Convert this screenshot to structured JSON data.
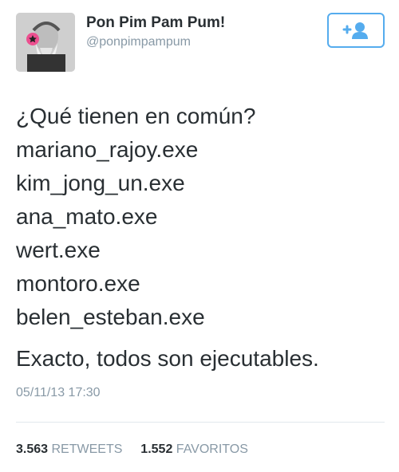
{
  "user": {
    "display_name": "Pon Pim Pam Pum!",
    "handle": "@ponpimpampum",
    "avatar_icon": "bearded-man-headphones-avatar",
    "follow_icon": "add-user-icon"
  },
  "tweet": {
    "lines": [
      "¿Qué tienen en común?",
      "mariano_rajoy.exe",
      "kim_jong_un.exe",
      "ana_mato.exe",
      "wert.exe",
      "montoro.exe",
      "belen_esteban.exe",
      "Exacto, todos son ejecutables."
    ],
    "timestamp": "05/11/13 17:30"
  },
  "stats": {
    "retweets_count": "3.563",
    "retweets_label": "RETWEETS",
    "favorites_count": "1.552",
    "favorites_label": "FAVORITOS"
  },
  "colors": {
    "accent": "#55acee",
    "text": "#292f33",
    "muted": "#8899a6",
    "headphone_pink": "#ec4f8f"
  }
}
